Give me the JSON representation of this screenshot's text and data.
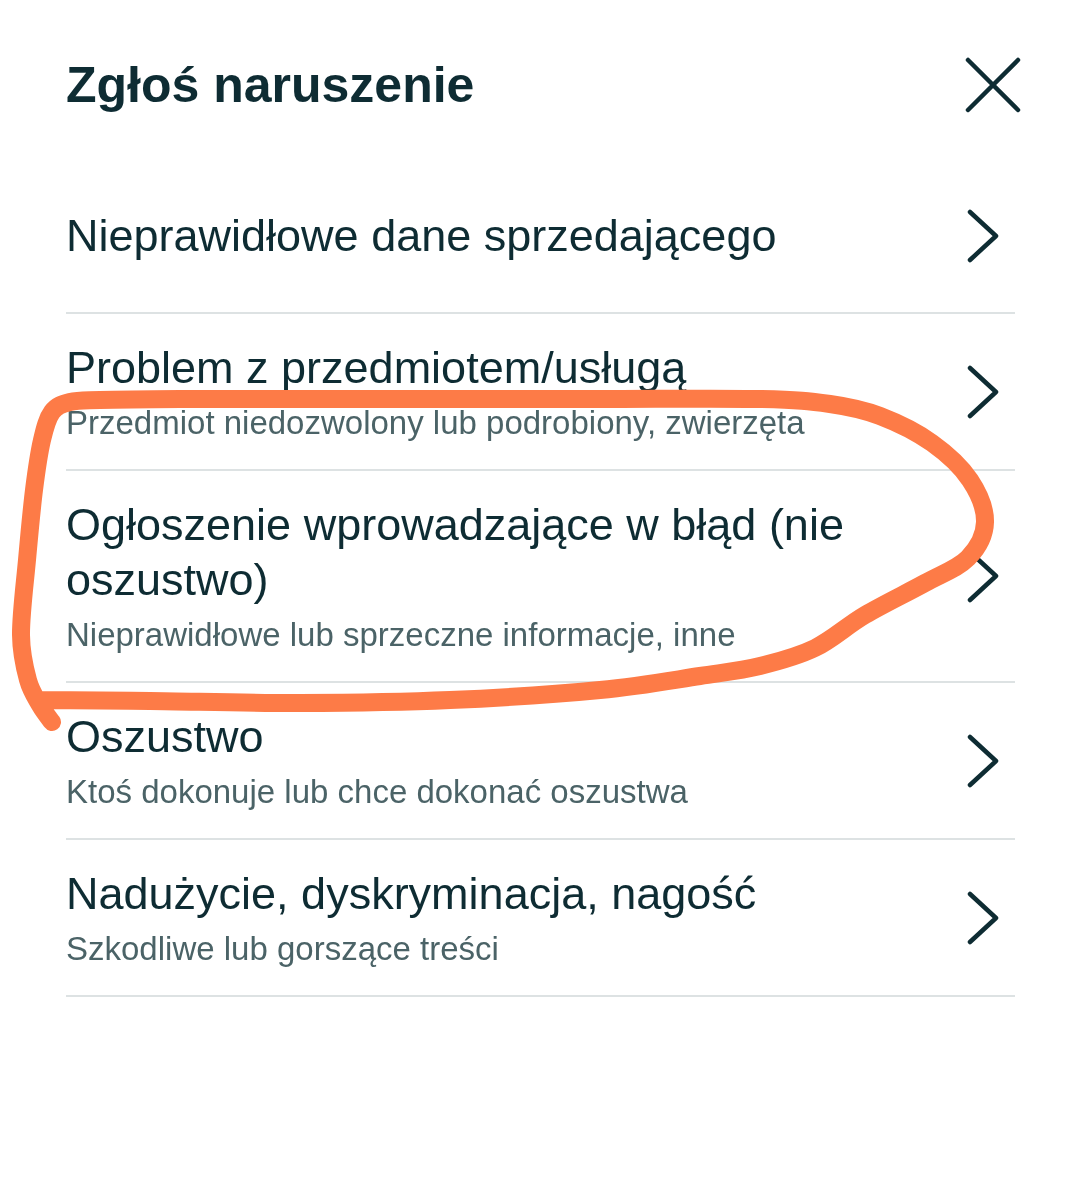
{
  "dialog": {
    "title": "Zgłoś naruszenie"
  },
  "options": [
    {
      "title": "Nieprawidłowe dane sprzedającego"
    },
    {
      "title": "Problem z przedmiotem/usługą",
      "subtitle": "Przedmiot niedozwolony lub podrobiony, zwierzęta"
    },
    {
      "title": "Ogłoszenie wprowadzające w błąd (nie oszustwo)",
      "subtitle": "Nieprawidłowe lub sprzeczne informacje, inne"
    },
    {
      "title": "Oszustwo",
      "subtitle": "Ktoś dokonuje lub chce dokonać oszustwa"
    },
    {
      "title": "Nadużycie, dyskryminacja, nagość",
      "subtitle": "Szkodliwe lub gorszące treści"
    }
  ],
  "overlay": {
    "kind": "scribble"
  }
}
